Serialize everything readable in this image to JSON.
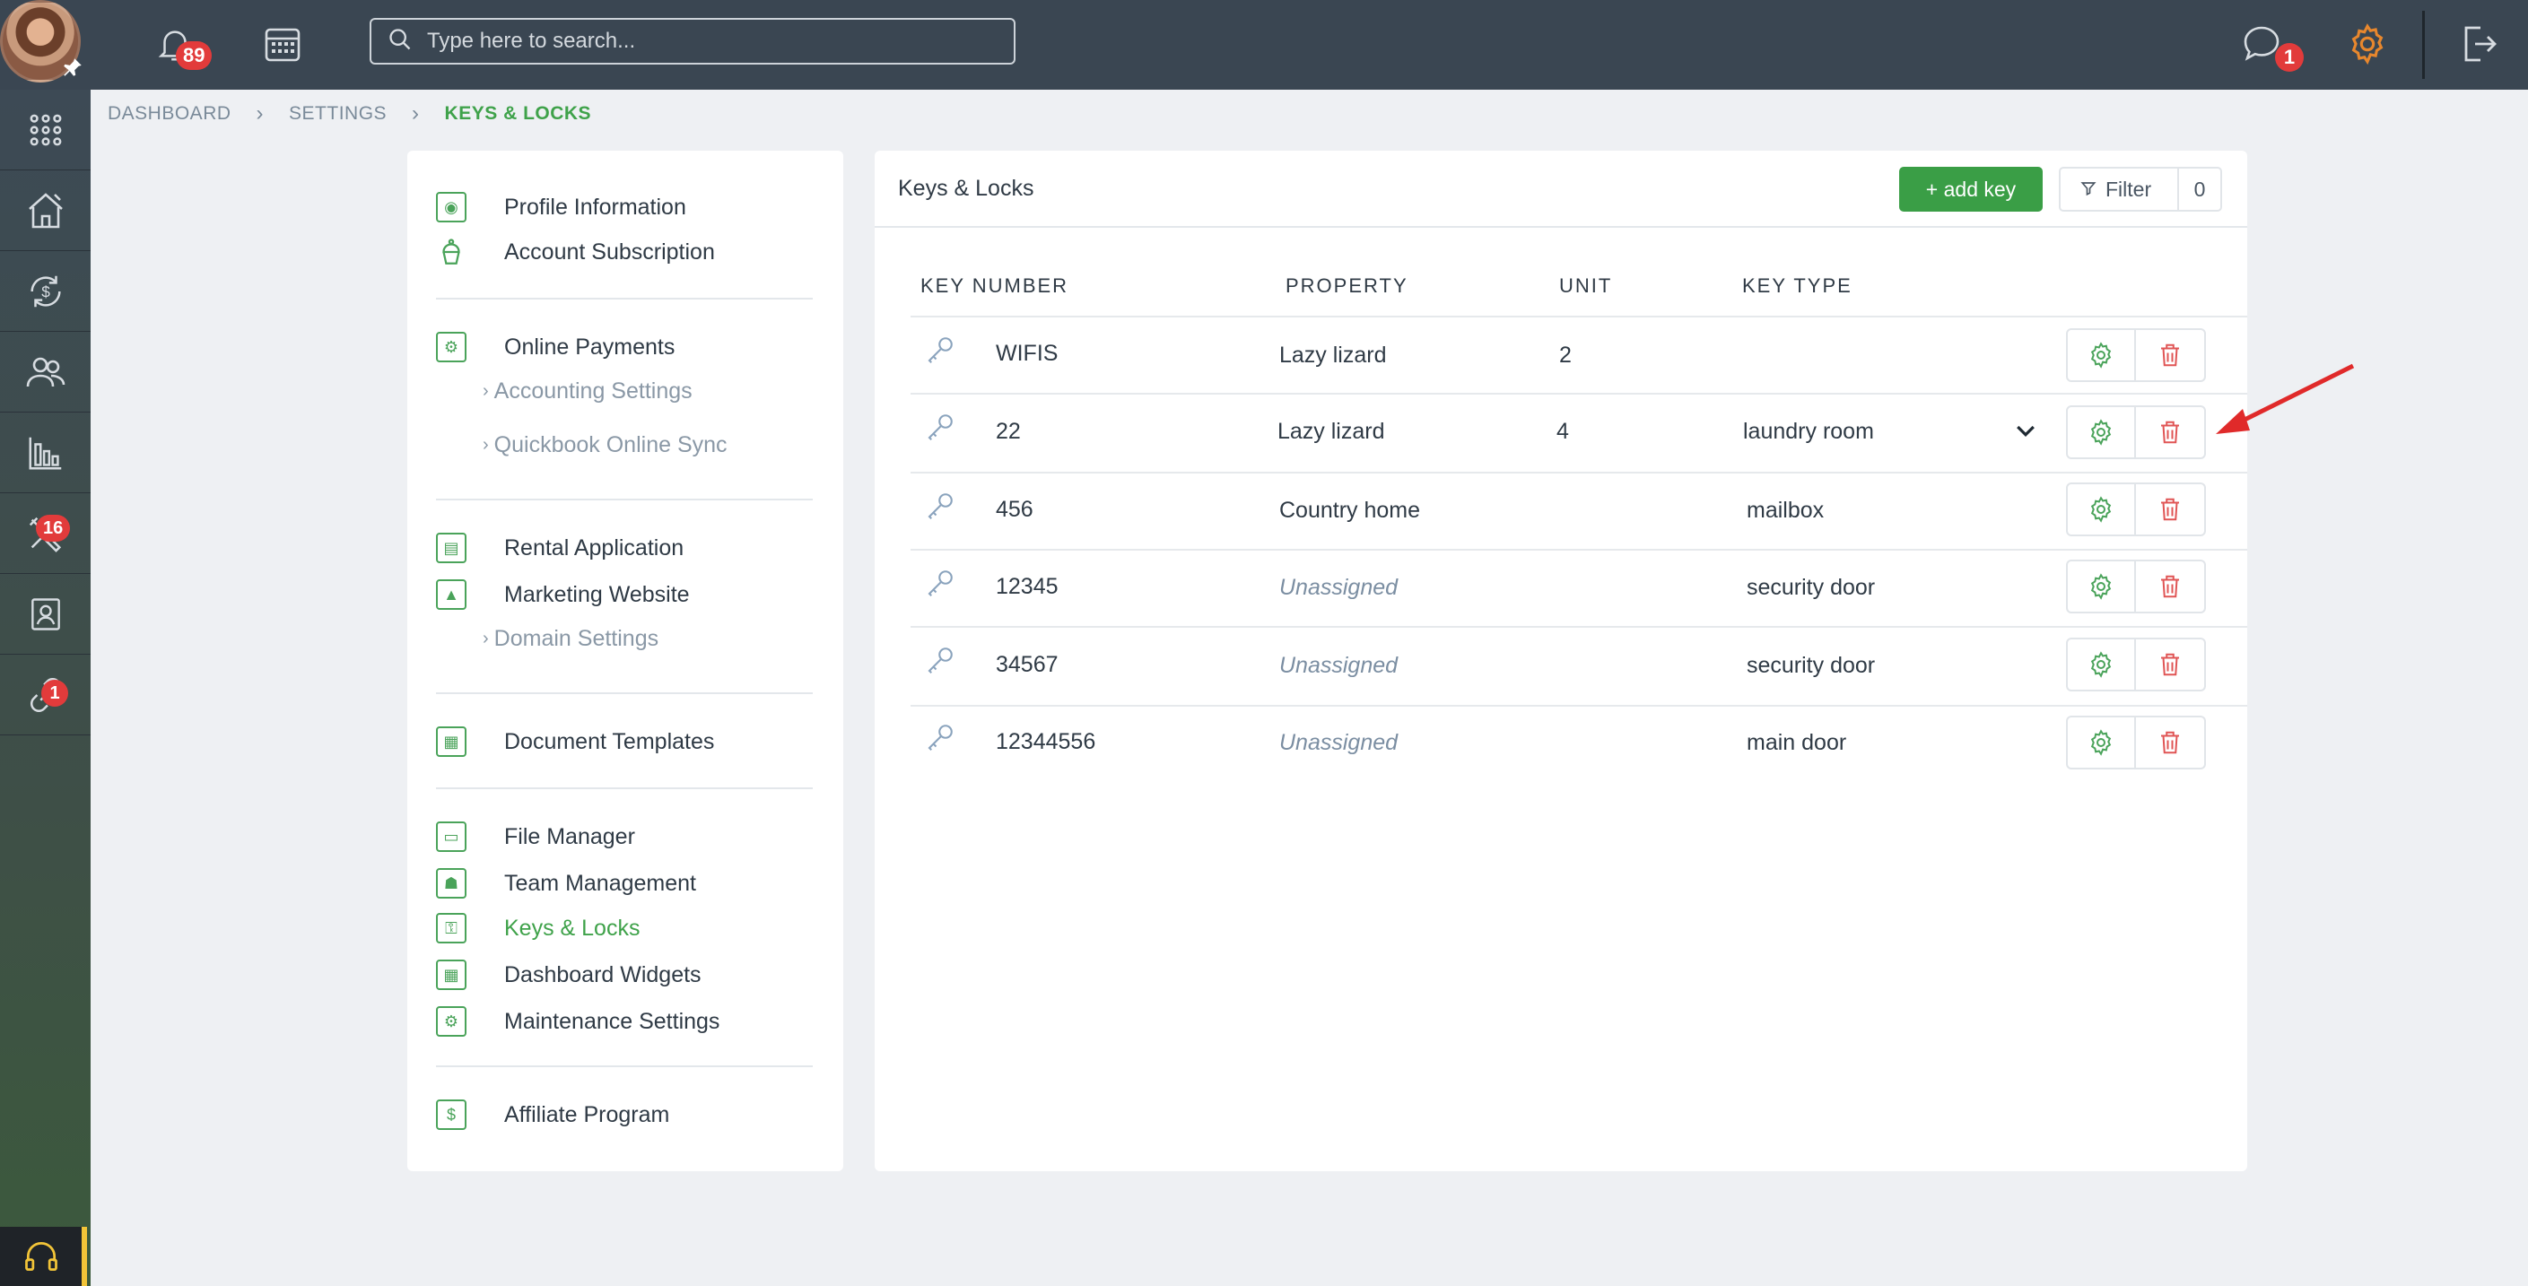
{
  "topbar": {
    "notifications_count": "89",
    "search_placeholder": "Type here to search...",
    "messages_count": "1"
  },
  "sidenav": {
    "maintenance_badge": "16",
    "integrations_badge": "1"
  },
  "breadcrumb": [
    "DASHBOARD",
    "SETTINGS",
    "KEYS & LOCKS"
  ],
  "settings_menu": {
    "profile": "Profile Information",
    "subscription": "Account Subscription",
    "online_payments": "Online Payments",
    "accounting_settings": "Accounting Settings",
    "quickbook_sync": "Quickbook Online Sync",
    "rental_application": "Rental Application",
    "marketing_website": "Marketing Website",
    "domain_settings": "Domain Settings",
    "document_templates": "Document Templates",
    "file_manager": "File Manager",
    "team_management": "Team Management",
    "keys_locks": "Keys & Locks",
    "dashboard_widgets": "Dashboard Widgets",
    "maintenance_settings": "Maintenance Settings",
    "affiliate_program": "Affiliate Program"
  },
  "main": {
    "title": "Keys & Locks",
    "add_key_label": "+ add key",
    "filter_label": "Filter",
    "filter_count": "0",
    "columns": [
      "KEY NUMBER",
      "PROPERTY",
      "UNIT",
      "KEY TYPE"
    ],
    "rows": [
      {
        "key": "WIFIS",
        "property": "Lazy lizard",
        "unit": "2",
        "type": ""
      },
      {
        "key": "22",
        "property": "Lazy lizard",
        "unit": "4",
        "type": "laundry room"
      },
      {
        "key": "456",
        "property": "Country home",
        "unit": "",
        "type": "mailbox"
      },
      {
        "key": "12345",
        "property": "Unassigned",
        "unit": "",
        "type": "security door"
      },
      {
        "key": "34567",
        "property": "Unassigned",
        "unit": "",
        "type": "security door"
      },
      {
        "key": "12344556",
        "property": "Unassigned",
        "unit": "",
        "type": "main door"
      }
    ]
  },
  "colors": {
    "accent_green": "#3fa24a",
    "delete_red": "#e05555",
    "topbar_bg": "#3a4652",
    "badge_red": "#e23b3b",
    "settings_orange": "#e8872d"
  }
}
